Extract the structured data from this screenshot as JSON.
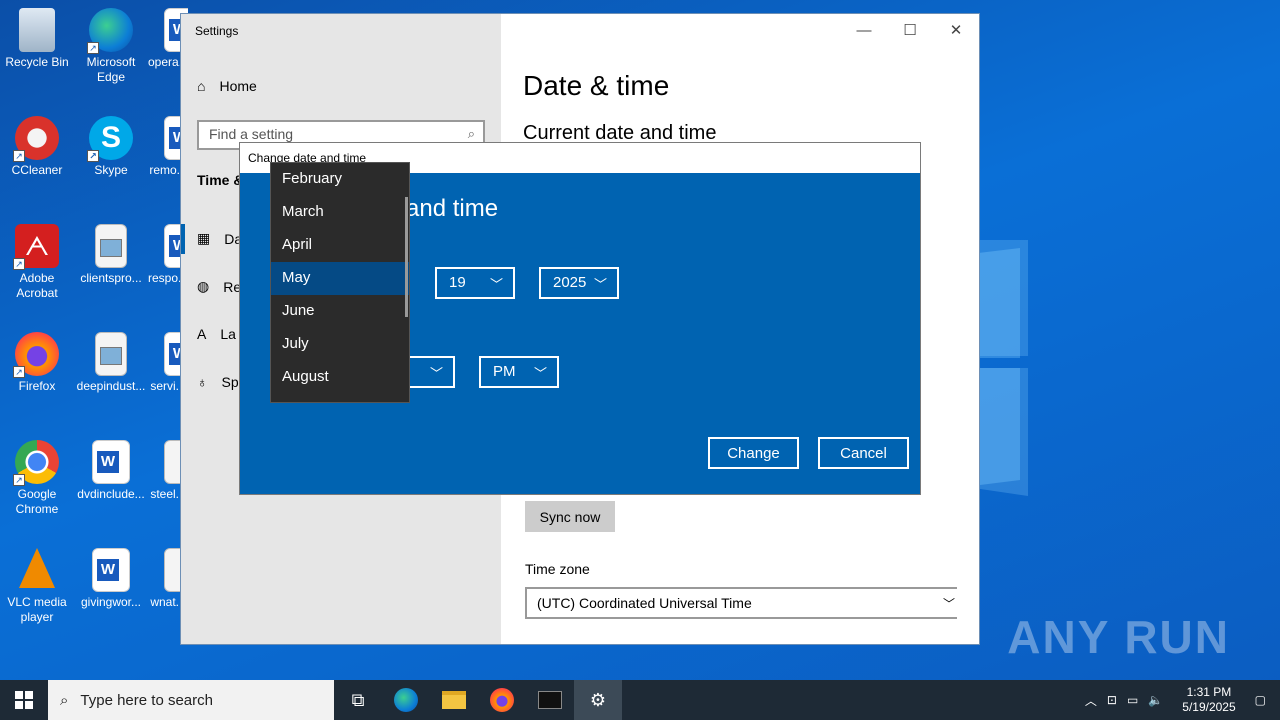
{
  "desktop": {
    "icons": [
      {
        "label": "Recycle Bin",
        "icon": "recycle-bin-icon"
      },
      {
        "label": "Microsoft Edge",
        "icon": "edge-icon"
      },
      {
        "label": "opera...",
        "icon": "word-doc-icon"
      },
      {
        "label": "CCleaner",
        "icon": "ccleaner-icon"
      },
      {
        "label": "Skype",
        "icon": "skype-icon"
      },
      {
        "label": "remo...",
        "icon": "word-doc-icon"
      },
      {
        "label": "Adobe Acrobat",
        "icon": "acrobat-icon"
      },
      {
        "label": "clientspro...",
        "icon": "image-doc-icon"
      },
      {
        "label": "respo...",
        "icon": "word-doc-icon"
      },
      {
        "label": "Firefox",
        "icon": "firefox-icon"
      },
      {
        "label": "deepindust...",
        "icon": "image-doc-icon"
      },
      {
        "label": "servi...",
        "icon": "word-doc-icon"
      },
      {
        "label": "Google Chrome",
        "icon": "chrome-icon"
      },
      {
        "label": "dvdinclude...",
        "icon": "word-doc-icon"
      },
      {
        "label": "steel...",
        "icon": "doc-icon"
      },
      {
        "label": "VLC media player",
        "icon": "vlc-icon"
      },
      {
        "label": "givingwor...",
        "icon": "word-doc-icon"
      },
      {
        "label": "wnat...",
        "icon": "doc-icon"
      }
    ],
    "watermark": "ANY RUN"
  },
  "settings": {
    "window_title": "Settings",
    "home_label": "Home",
    "search_placeholder": "Find a setting",
    "side_header": "Time &",
    "side_items": [
      "Da",
      "Re",
      "La",
      "Sp"
    ],
    "page_title": "Date & time",
    "section_title": "Current date and time",
    "sync_button": "Sync now",
    "timezone_label": "Time zone",
    "timezone_value": "(UTC) Coordinated Universal Time"
  },
  "dialog": {
    "title": "Change date and time",
    "heading": "and time",
    "day": "19",
    "year": "2025",
    "ampm": "PM",
    "change_button": "Change",
    "cancel_button": "Cancel"
  },
  "month_dropdown": {
    "items": [
      "February",
      "March",
      "April",
      "May",
      "June",
      "July",
      "August"
    ],
    "selected": "May"
  },
  "taskbar": {
    "search_placeholder": "Type here to search",
    "time": "1:31 PM",
    "date": "5/19/2025"
  },
  "colors": {
    "accent": "#0063b1",
    "selected_month": "#054a85",
    "dropdown_bg": "#2b2b2b",
    "taskbar": "#1e2a36"
  }
}
